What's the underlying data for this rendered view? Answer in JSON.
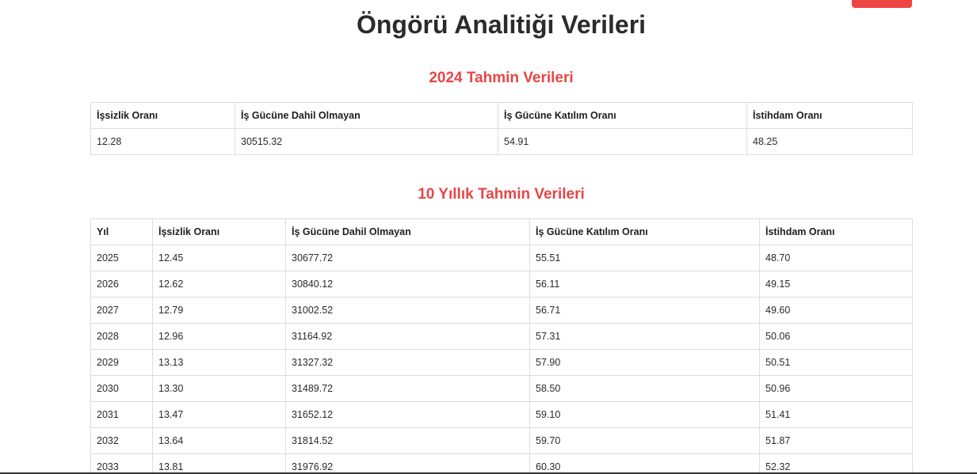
{
  "page": {
    "title": "Öngörü Analitiği Verileri"
  },
  "section_2024": {
    "title": "2024 Tahmin Verileri",
    "headers": [
      "İşsizlik Oranı",
      "İş Gücüne Dahil Olmayan",
      "İş Gücüne Katılım Oranı",
      "İstihdam Oranı"
    ],
    "row": [
      "12.28",
      "30515.32",
      "54.91",
      "48.25"
    ]
  },
  "section_10y": {
    "title": "10 Yıllık Tahmin Verileri",
    "headers": [
      "Yıl",
      "İşsizlik Oranı",
      "İş Gücüne Dahil Olmayan",
      "İş Gücüne Katılım Oranı",
      "İstihdam Oranı"
    ],
    "rows": [
      [
        "2025",
        "12.45",
        "30677.72",
        "55.51",
        "48.70"
      ],
      [
        "2026",
        "12.62",
        "30840.12",
        "56.11",
        "49.15"
      ],
      [
        "2027",
        "12.79",
        "31002.52",
        "56.71",
        "49.60"
      ],
      [
        "2028",
        "12.96",
        "31164.92",
        "57.31",
        "50.06"
      ],
      [
        "2029",
        "13.13",
        "31327.32",
        "57.90",
        "50.51"
      ],
      [
        "2030",
        "13.30",
        "31489.72",
        "58.50",
        "50.96"
      ],
      [
        "2031",
        "13.47",
        "31652.12",
        "59.10",
        "51.41"
      ],
      [
        "2032",
        "13.64",
        "31814.52",
        "59.70",
        "51.87"
      ],
      [
        "2033",
        "13.81",
        "31976.92",
        "60.30",
        "52.32"
      ]
    ]
  },
  "colors": {
    "accent": "#e84545",
    "button": "#ee4444"
  }
}
